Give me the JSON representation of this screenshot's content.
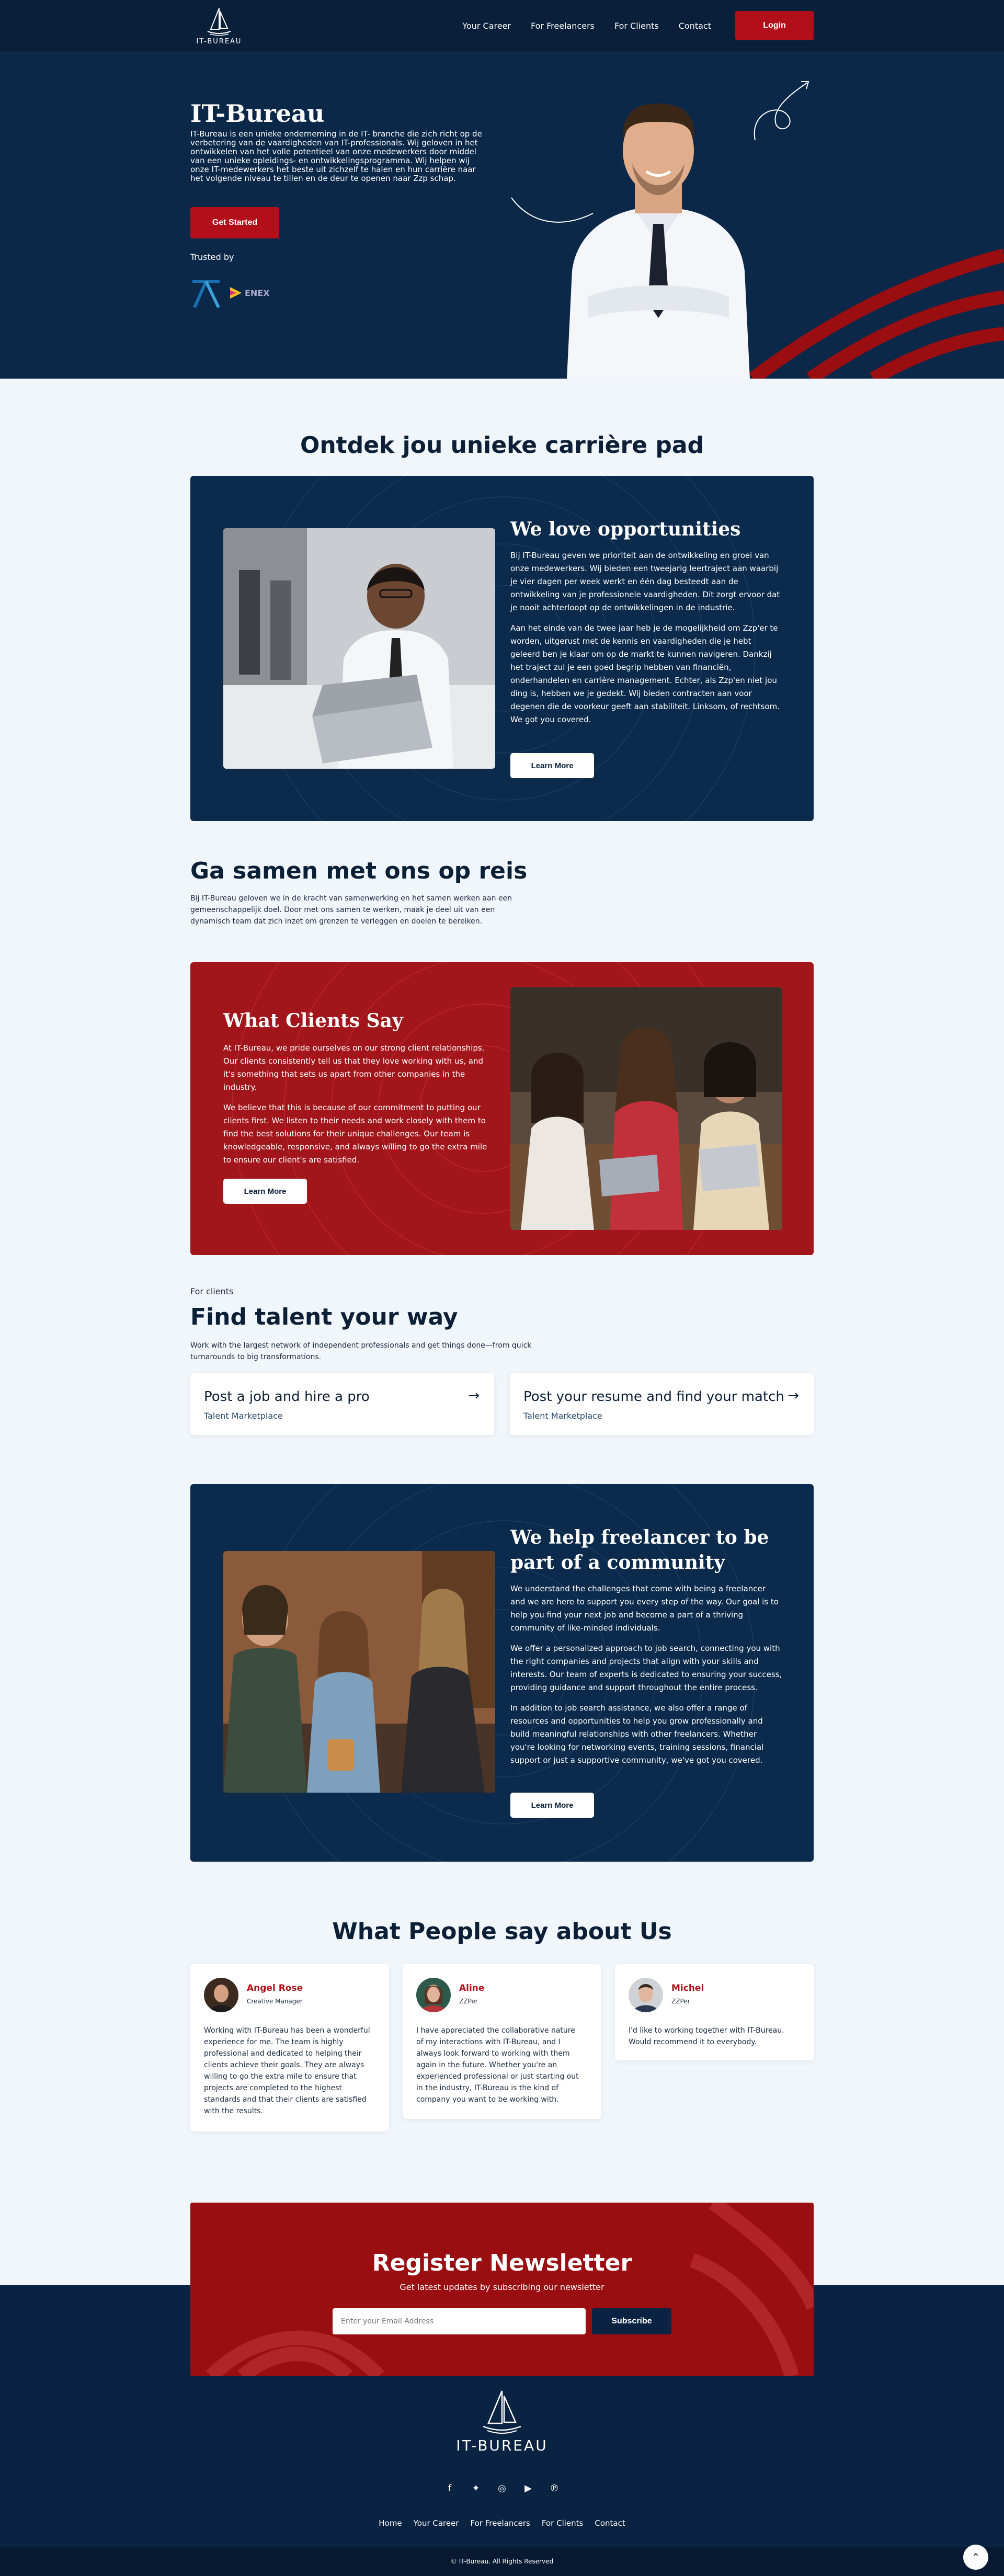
{
  "header": {
    "logo_text": "IT-BUREAU",
    "nav": [
      "Your Career",
      "For Freelancers",
      "For Clients",
      "Contact"
    ],
    "login_label": "Login"
  },
  "hero": {
    "title": "IT-Bureau",
    "intro": "IT-Bureau is een unieke onderneming in de IT- branche die zich richt op de verbetering van de vaardigheden van IT-professionals. Wij geloven in het ontwikkelen van het volle potentieel van onze medewerkers door middel van een unieke opleidings- en ontwikkelingsprogramma. Wij helpen wij onze IT-medewerkers het beste uit zichzelf te halen en hun carrière naar het volgende niveau te tillen en de deur te openen naar Zzp schap.",
    "cta_label": "Get Started",
    "trusted_label": "Trusted by",
    "brand_name": "ENEX"
  },
  "discover": {
    "title": "Ontdek jou unieke carrière pad",
    "card_title": "We love opportunities",
    "paragraphs": [
      "Bij IT-Bureau geven we prioriteit aan de ontwikkeling en groei van onze medewerkers. Wij bieden een tweejarig leertraject aan waarbij je vier dagen per week werkt en één dag besteedt aan de ontwikkeling van je professionele vaardigheden. Dit zorgt ervoor dat je nooit achterloopt op de ontwikkelingen in de industrie.",
      "Aan het einde van de twee jaar heb je de mogelijkheid om Zzp'er te worden, uitgerust met de kennis en vaardigheden die je hebt geleerd ben je klaar om op de markt te kunnen navigeren. Dankzij het traject zul je een goed begrip hebben van financiën, onderhandelen en carrière management. Echter, als Zzp'en niet jou ding is, hebben we je gedekt. Wij bieden contracten aan voor degenen die de voorkeur geeft aan stabiliteit. Linksom, of rechtsom. We got you covered."
    ],
    "button": "Learn More"
  },
  "journey": {
    "title": "Ga samen met ons op reis",
    "text": "Bij IT-Bureau geloven we in de kracht van samenwerking en het samen werken aan een gemeenschappelijk doel. Door met ons samen te werken, maak je deel uit van een dynamisch team dat zich inzet om grenzen te verleggen en doelen te bereiken."
  },
  "clients_say": {
    "title": "What Clients Say",
    "paragraphs": [
      "At IT-Bureau, we pride ourselves on our strong client relationships. Our clients consistently tell us that they love working with us, and it's something that sets us apart from other companies in the industry.",
      "We believe that this is because of our commitment to putting our clients first. We listen to their needs and work closely with them to find the best solutions for their unique challenges. Our team is knowledgeable, responsive, and always willing to go the extra mile to ensure our client's are satisfied."
    ],
    "button": "Learn More"
  },
  "clients": {
    "eyebrow": "For clients",
    "title": "Find talent your way",
    "text": "Work with the largest network of independent professionals and get things done—from quick turnarounds to big transformations.",
    "tiles": [
      {
        "title": "Post a job and hire a pro",
        "sub": "Talent Marketplace"
      },
      {
        "title": "Post your resume and find your match",
        "sub": "Talent Marketplace"
      }
    ]
  },
  "freelancer": {
    "title": "We help freelancer to be part of a community",
    "paragraphs": [
      "We understand the challenges that come with being a freelancer and we are here to support you every step of the way. Our goal is to help you find your next job and become a part of a thriving community of like-minded individuals.",
      "We offer a personalized approach to job search, connecting you with the right companies and projects that align with your skills and interests. Our team of experts is dedicated to ensuring your success, providing guidance and support throughout the entire process.",
      "In addition to job search assistance, we also offer a range of resources and opportunities to help you grow professionally and build meaningful relationships with other freelancers. Whether you're looking for networking events, training sessions, financial support or just a supportive community, we've got you covered."
    ],
    "button": "Learn More"
  },
  "testimonials": {
    "title": "What People say about Us",
    "items": [
      {
        "name": "Angel Rose",
        "role": "Creative Manager",
        "text": "Working with IT-Bureau has been a wonderful experience for me. The team is highly professional and dedicated to helping their clients achieve their goals. They are always willing to go the extra mile to ensure that projects are completed to the highest standards and that their clients are satisfied with the results."
      },
      {
        "name": "Aline",
        "role": "ZZPer",
        "text": "I have appreciated the collaborative nature of my interactions with IT-Bureau, and I always look forward to working with them again in the future. Whether you're an experienced professional or just starting out in the industry, IT-Bureau is the kind of company you want to be working with."
      },
      {
        "name": "Michel",
        "role": "ZZPer",
        "text": "I'd like to working together with IT-Bureau. Would recommend it to everybody."
      }
    ]
  },
  "newsletter": {
    "title": "Register Newsletter",
    "sub": "Get latest updates by subscribing our newsletter",
    "placeholder": "Enter your Email Address",
    "button": "Subscribe"
  },
  "footer": {
    "logo_text": "IT-BUREAU",
    "nav": [
      "Home",
      "Your Career",
      "For Freelancers",
      "For Clients",
      "Contact"
    ],
    "copyright": "© IT-Bureau. All Rights Reserved",
    "socials": [
      "facebook-icon",
      "twitter-icon",
      "instagram-icon",
      "youtube-icon",
      "pinterest-icon"
    ]
  },
  "colors": {
    "navy": "#0a2240",
    "red": "#b30f1a",
    "light_bg": "#f1f6fb"
  }
}
